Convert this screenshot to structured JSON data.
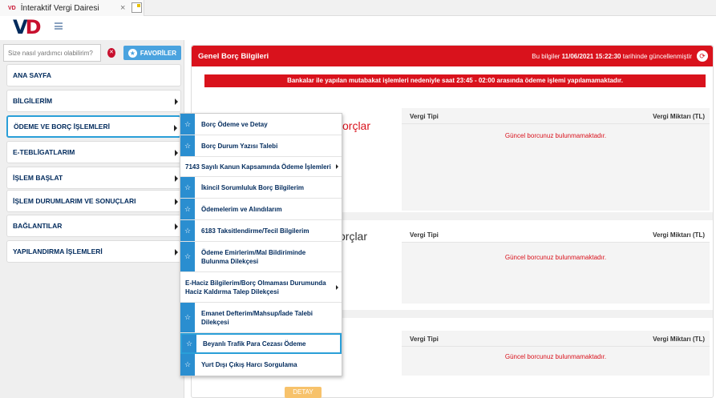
{
  "browser": {
    "tab_title": "İnteraktif Vergi Dairesi",
    "tab_close": "×",
    "favicon": "VD"
  },
  "app": {
    "logo": "VD",
    "icons": [
      "hamburger-icon",
      "search-clear-icon",
      "star-icon",
      "refresh-icon",
      "chevron-right-icon"
    ]
  },
  "sidebar": {
    "search_placeholder": "Size nasıl yardımcı olabilirim?",
    "favorites_label": "FAVORİLER",
    "items": [
      {
        "label": "ANA SAYFA"
      },
      {
        "label": "BİLGİLERİM"
      },
      {
        "label": "ÖDEME VE BORÇ İŞLEMLERİ"
      },
      {
        "label": "E-TEBLİGATLARIM"
      },
      {
        "label": "İŞLEM BAŞLAT"
      },
      {
        "label": "İŞLEM DURUMLARIM VE SONUÇLARI"
      },
      {
        "label": "BAĞLANTILAR"
      },
      {
        "label": "YAPILANDIRMA İŞLEMLERİ"
      }
    ]
  },
  "main": {
    "title": "Genel Borç Bilgileri",
    "update_prefix": "Bu bilgiler ",
    "update_datetime": "11/06/2021 15:22:30",
    "update_suffix": " tarihinde güncellenmiştir",
    "banner": "Bankalar ile yapılan mutabakat işlemleri nedeniyle saat 23:45 - 02:00 arasında ödeme işlemi yapılamamaktadır.",
    "section1_title_fragment": "orçlar",
    "section2_title_fragment": "orçlar",
    "table_col_type": "Vergi Tipi",
    "table_col_amount": "Vergi Miktarı (TL)",
    "no_debt": "Güncel borcunuz bulunmamaktadır.",
    "detay_button": "DETAY"
  },
  "submenu": {
    "items": [
      {
        "label": "Borç Ödeme ve Detay",
        "star": true
      },
      {
        "label": "Borç Durum Yazısı Talebi",
        "star": true
      },
      {
        "label": "7143 Sayılı Kanun Kapsamında Ödeme İşlemleri",
        "star": false
      },
      {
        "label": "İkincil Sorumluluk Borç Bilgilerim",
        "star": true
      },
      {
        "label": "Ödemelerim ve Alındılarım",
        "star": true
      },
      {
        "label": "6183 Taksitlendirme/Tecil Bilgilerim",
        "star": true
      },
      {
        "label": "Ödeme Emirlerim/Mal Bildiriminde Bulunma Dilekçesi",
        "star": true
      },
      {
        "label": "E-Haciz Bilgilerim/Borç Olmaması Durumunda Haciz Kaldırma Talep Dilekçesi",
        "star": false
      },
      {
        "label": "Emanet Defterim/Mahsup/İade Talebi Dilekçesi",
        "star": true
      },
      {
        "label": "Beyanlı Trafik Para Cezası Ödeme",
        "star": true
      },
      {
        "label": "Yurt Dışı Çıkış Harcı Sorgulama",
        "star": true
      }
    ]
  },
  "colors": {
    "brand_red": "#d9121c",
    "brand_navy": "#002a5c",
    "accent_blue": "#2a9fd8"
  }
}
